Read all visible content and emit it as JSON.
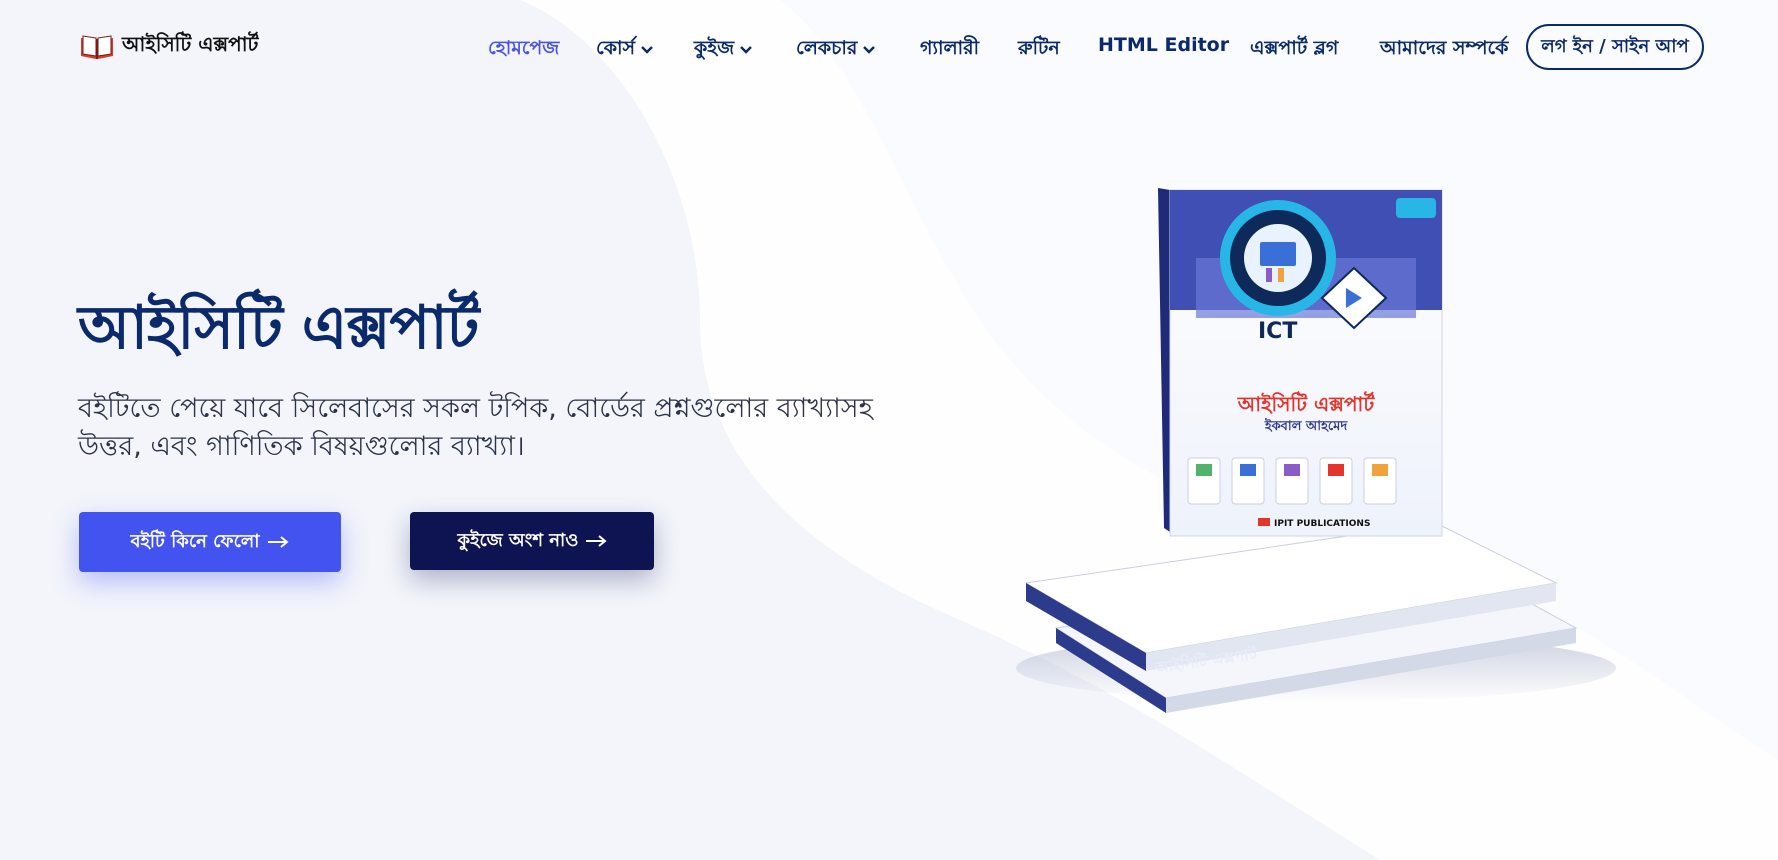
{
  "brand": {
    "name": "আইসিটি এক্সপার্ট",
    "logo_icon": "open-book-icon"
  },
  "nav": {
    "items": [
      {
        "label": "হোমপেজ",
        "active": true,
        "has_dropdown": false
      },
      {
        "label": "কোর্স",
        "active": false,
        "has_dropdown": true
      },
      {
        "label": "কুইজ",
        "active": false,
        "has_dropdown": true
      },
      {
        "label": "লেকচার",
        "active": false,
        "has_dropdown": true
      },
      {
        "label": "গ্যালারী",
        "active": false,
        "has_dropdown": false
      },
      {
        "label": "রুটিন",
        "active": false,
        "has_dropdown": false
      },
      {
        "label": "HTML Editor",
        "active": false,
        "has_dropdown": false
      },
      {
        "label": "এক্সপার্ট ব্লগ",
        "active": false,
        "has_dropdown": false
      },
      {
        "label": "আমাদের সম্পর্কে",
        "active": false,
        "has_dropdown": false
      }
    ],
    "login_label": "লগ ইন / সাইন আপ"
  },
  "hero": {
    "title": "আইসিটি এক্সপার্ট",
    "subtitle": "বইটিতে পেয়ে যাবে সিলেবাসের সকল টপিক, বোর্ডের প্রশ্নগুলোর ব্যাখ্যাসহ উত্তর, এবং গাণিতিক বিষয়গুলোর ব্যাখ্যা।",
    "buy_button": "বইটি কিনে ফেলো",
    "quiz_button": "কুইজে অংশ নাও"
  },
  "book": {
    "cover_title": "আইসিটি এক্সপার্ট",
    "author": "ইকবাল আহমেদ",
    "badge": "ICT",
    "publisher": "IPIT PUBLICATIONS"
  },
  "colors": {
    "navy": "#0b2a6b",
    "accent": "#4a55e6",
    "primary_button": "#4353ef",
    "dark_button": "#0e1452",
    "background": "#f3f5fb"
  }
}
